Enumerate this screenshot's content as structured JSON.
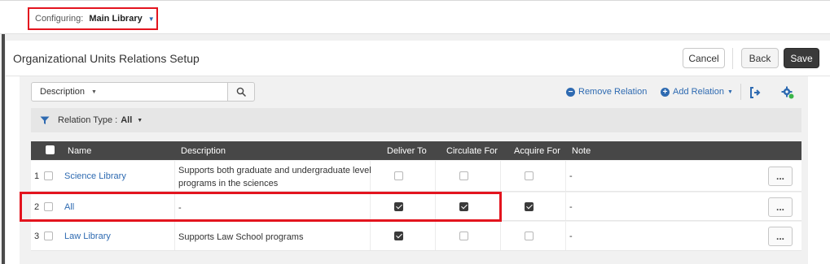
{
  "header": {
    "configuring_label": "Configuring:",
    "library": "Main Library"
  },
  "page": {
    "title": "Organizational Units Relations Setup",
    "cancel_label": "Cancel",
    "back_label": "Back",
    "save_label": "Save"
  },
  "toolbar": {
    "search_field": "Description",
    "search_value": "",
    "remove_relation": "Remove Relation",
    "add_relation": "Add Relation",
    "icons": [
      "search-icon",
      "export-icon",
      "settings-icon",
      "filter-icon"
    ]
  },
  "filter": {
    "name": "Relation Type :",
    "value": "All"
  },
  "table": {
    "columns": [
      "Name",
      "Description",
      "Deliver To",
      "Circulate For",
      "Acquire For",
      "Note"
    ],
    "rows": [
      {
        "num": "1",
        "name": "Science Library",
        "description_line1": "Supports both graduate and undergraduate level",
        "description_line2": "programs in the sciences",
        "deliver_to": false,
        "circulate_for": false,
        "acquire_for": false,
        "note": "-",
        "more": "..."
      },
      {
        "num": "2",
        "name": "All",
        "description_line1": "-",
        "deliver_to": true,
        "circulate_for": true,
        "acquire_for": true,
        "note": "-",
        "more": "..."
      },
      {
        "num": "3",
        "name": "Law Library",
        "description_line1": "Supports Law School programs",
        "deliver_to": true,
        "circulate_for": false,
        "acquire_for": false,
        "note": "-",
        "more": "..."
      }
    ]
  },
  "colors": {
    "highlight": "#e3141e",
    "link": "#2e6ab1",
    "header_bg": "#474747",
    "save_bg": "#3a3a3a"
  }
}
